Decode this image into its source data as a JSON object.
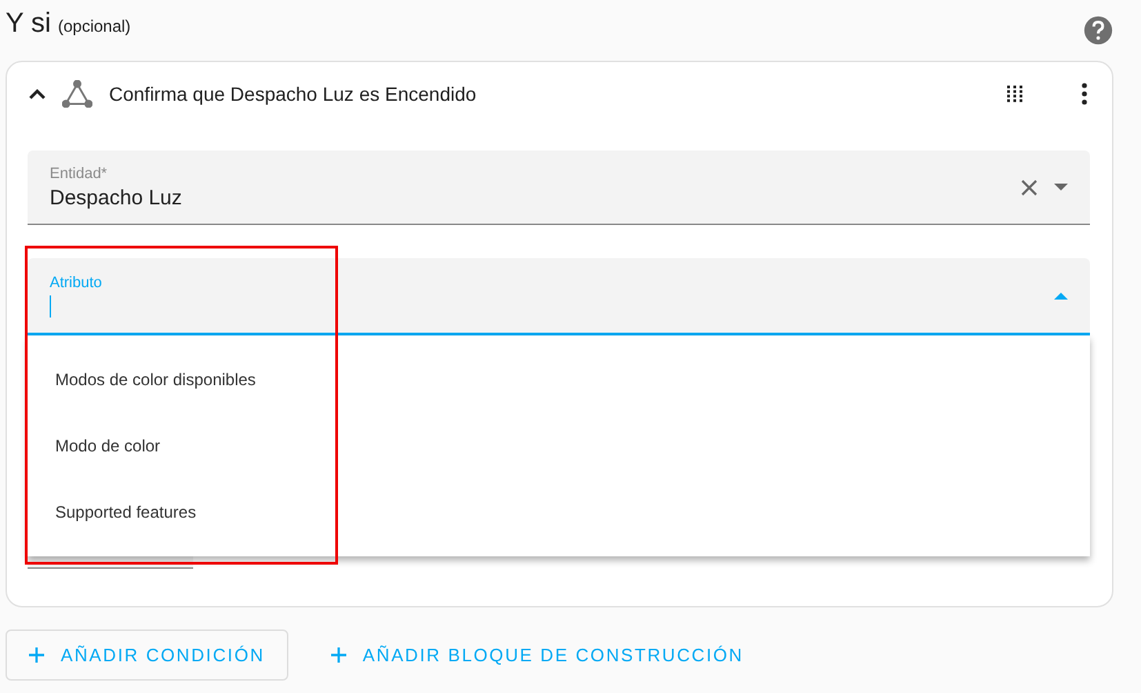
{
  "section": {
    "title": "Y si",
    "note": "(opcional)"
  },
  "condition": {
    "title": "Confirma que Despacho Luz es Encendido",
    "expanded": true,
    "entity_field": {
      "label": "Entidad*",
      "value": "Despacho Luz"
    },
    "attribute_field": {
      "label": "Atributo",
      "open": true,
      "options": [
        {
          "label": "Modos de color disponibles"
        },
        {
          "label": "Modo de color"
        },
        {
          "label": "Supported features"
        }
      ]
    }
  },
  "buttons": [
    {
      "label": "AÑADIR CONDICIÓN",
      "kind": "outlined"
    },
    {
      "label": "AÑADIR BLOQUE DE CONSTRUCCIÓN",
      "kind": "text"
    }
  ]
}
